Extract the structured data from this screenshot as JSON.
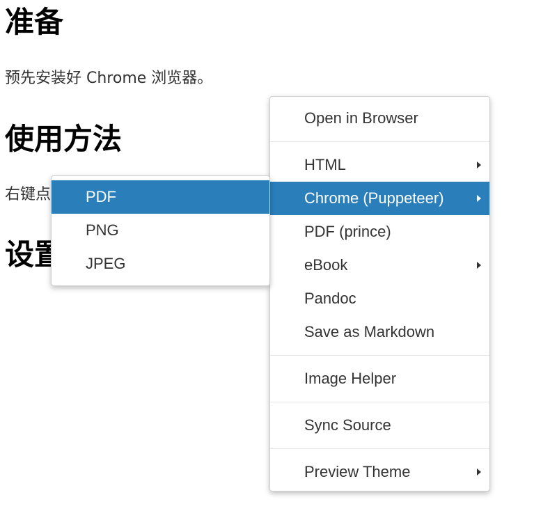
{
  "document": {
    "heading_prep": "准备",
    "para_prep": "预先安装好 Chrome 浏览器。",
    "heading_usage": "使用方法",
    "para_usage": "右键点",
    "heading_settings": "设置"
  },
  "main_menu": {
    "open_in_browser": "Open in Browser",
    "html": "HTML",
    "chrome_puppeteer": "Chrome (Puppeteer)",
    "pdf_prince": "PDF (prince)",
    "ebook": "eBook",
    "pandoc": "Pandoc",
    "save_as_markdown": "Save as Markdown",
    "image_helper": "Image Helper",
    "sync_source": "Sync Source",
    "preview_theme": "Preview Theme"
  },
  "sub_menu": {
    "pdf": "PDF",
    "png": "PNG",
    "jpeg": "JPEG"
  },
  "colors": {
    "highlight": "#2a7fba",
    "text": "#333333"
  }
}
